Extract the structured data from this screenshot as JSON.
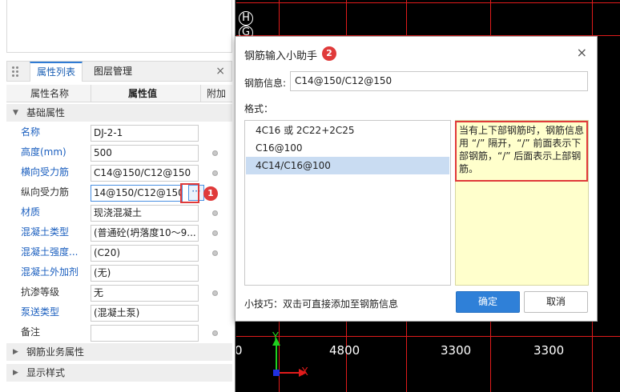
{
  "panel": {
    "tabs": [
      "属性列表",
      "图层管理"
    ],
    "close_glyph": "×",
    "columns": {
      "name": "属性名称",
      "value": "属性值",
      "extra": "附加"
    },
    "groups": {
      "basic": "基础属性",
      "rebar_business": "钢筋业务属性",
      "display_style": "显示样式"
    },
    "rows": [
      {
        "name": "名称",
        "value": "DJ-2-1",
        "blue": true,
        "dot": false
      },
      {
        "name": "高度(mm)",
        "value": "500",
        "blue": true,
        "dot": true
      },
      {
        "name": "横向受力筋",
        "value": "C14@150/C12@150",
        "blue": true,
        "dot": true
      },
      {
        "name": "纵向受力筋",
        "value": "14@150/C12@150",
        "blue": false,
        "dot": false
      },
      {
        "name": "材质",
        "value": "现浇混凝土",
        "blue": true,
        "dot": true
      },
      {
        "name": "混凝土类型",
        "value": "(普通砼(坍落度10～9...",
        "blue": true,
        "dot": true
      },
      {
        "name": "混凝土强度...",
        "value": "(C20)",
        "blue": true,
        "dot": true
      },
      {
        "name": "混凝土外加剂",
        "value": "(无)",
        "blue": true,
        "dot": false
      },
      {
        "name": "抗渗等级",
        "value": "无",
        "blue": false,
        "dot": true
      },
      {
        "name": "泵送类型",
        "value": "(混凝土泵)",
        "blue": true,
        "dot": false
      },
      {
        "name": "备注",
        "value": "",
        "blue": false,
        "dot": true
      }
    ],
    "ellipsis": "···",
    "callout_1": "1"
  },
  "cad": {
    "dimensions": [
      "0",
      "4800",
      "3300",
      "3300"
    ],
    "grid_labels": [
      "H",
      "G"
    ],
    "axis_x": "X",
    "axis_y": "Y",
    "line_color": "#e01b1b"
  },
  "dialog": {
    "title": "钢筋输入小助手",
    "callout_2": "2",
    "close_glyph": "×",
    "info_label": "钢筋信息:",
    "info_value": "C14@150/C12@150",
    "format_label": "格式：",
    "formats": [
      "4C16 或 2C22+2C25",
      "C16@100",
      "4C14/C16@100"
    ],
    "selected_format": 2,
    "description": "当有上下部钢筋时，钢筋信息用 “/” 隔开，“/” 前面表示下部钢筋，“/” 后面表示上部钢筋。",
    "tip": "小技巧：双击可直接添加至钢筋信息",
    "ok_label": "确定",
    "cancel_label": "取消"
  }
}
